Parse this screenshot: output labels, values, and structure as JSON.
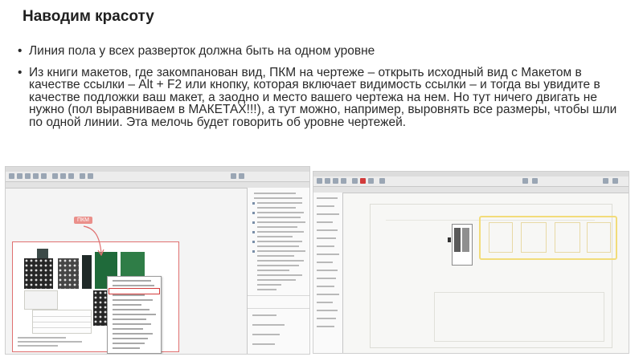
{
  "slide": {
    "title": "Наводим красоту",
    "bullets": [
      "Линия пола у всех разверток должна быть на одном уровне",
      "Из книги макетов, где закомпанован вид, ПКМ на чертеже – открыть исходный вид с Макетом в качестве ссылки – Alt + F2 или кнопку, которая включает видимость ссылки – и тогда вы увидите в качестве подложки ваш макет, а заодно и место вашего чертежа на нем. Но тут ничего двигать не нужно (пол выравниваем в МАКЕТАХ!!!), а тут можно, например, выровнять все размеры, чтобы шли по одной линии. Эта мелочь будет говорить об уровне чертежей."
    ]
  },
  "left_screenshot": {
    "callout_label": "ПКМ"
  },
  "colors": {
    "callout": "#ea8f8a",
    "highlight_red": "#d23b3b",
    "overlay_yellow": "#f2dc7a"
  }
}
